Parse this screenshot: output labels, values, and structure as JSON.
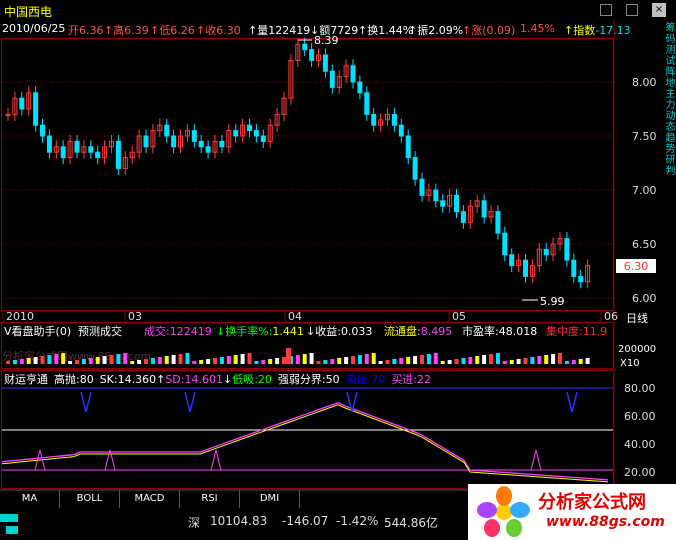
{
  "stock": {
    "name": "中国西电",
    "date": "2010/06/25",
    "open_label": "开",
    "open": "6.36",
    "high_label": "高",
    "high": "6.39",
    "low_label": "低",
    "low": "6.26",
    "close_label": "收",
    "close": "6.30",
    "volume_label": "量",
    "volume": "122419",
    "amount_label": "额",
    "amount": "7729",
    "turnover_label": "换",
    "turnover": "1.44%",
    "amplitude_label": "振",
    "amplitude": "2.09%",
    "change_label": "涨",
    "change": "(0.09)",
    "change_pct": "1.45%",
    "index_label": "指数",
    "index_value": "-17.13"
  },
  "price_axis": {
    "ticks": [
      "8.00",
      "7.50",
      "7.00",
      "6.50",
      "6.00"
    ],
    "current": "6.30",
    "max_label": "8.39",
    "min_label": "5.99"
  },
  "time_axis": {
    "labels": [
      "2010",
      "03",
      "04",
      "05",
      "06"
    ],
    "period": "日线"
  },
  "volume_panel": {
    "title": "V看盘助手(0)",
    "predict_label": "预测成交",
    "volume_label": "成交:",
    "volume_value": "122419",
    "turnover_label": "换手率%:",
    "turnover_value": "1.441",
    "income_label": "收益:",
    "income_value": "0.033",
    "float_label": "流通盘:",
    "float_value": "8.495",
    "pe_label": "市盈率:",
    "pe_value": "48.018",
    "concentration_label": "集中度:",
    "concentration_value": "11.9",
    "scale_top": "200000",
    "scale_unit": "X10",
    "watermark": "分析家公式网www.88gs.com"
  },
  "indicator_panel": {
    "title": "财运亨通",
    "high_sell": "高抛:80",
    "sk": "SK:14.360",
    "sd": "SD:14.601",
    "low_buy": "低吸:20",
    "boundary": "强弱分界:50",
    "sell_out": "卖出:70",
    "buy_in": "买进:22",
    "ticks": [
      "80.00",
      "60.00",
      "40.00",
      "20.00"
    ]
  },
  "tabs": [
    "MA",
    "BOLL",
    "MACD",
    "RSI",
    "DMI"
  ],
  "status": {
    "market": "深",
    "index": "10104.83",
    "change": "-146.07",
    "pct": "-1.42%",
    "amount": "544.86亿"
  },
  "logo": {
    "title": "分析家公式网",
    "url": "www.88gs.com"
  },
  "right_sidebar_text": "筹码测试阵地主力动态趋势研判",
  "colors": {
    "up": "#ff3c3c",
    "down": "#00e0ff",
    "grid": "#8b0000",
    "magenta": "#ff40ff",
    "yellow": "#ffff00",
    "green": "#00ff00"
  }
}
